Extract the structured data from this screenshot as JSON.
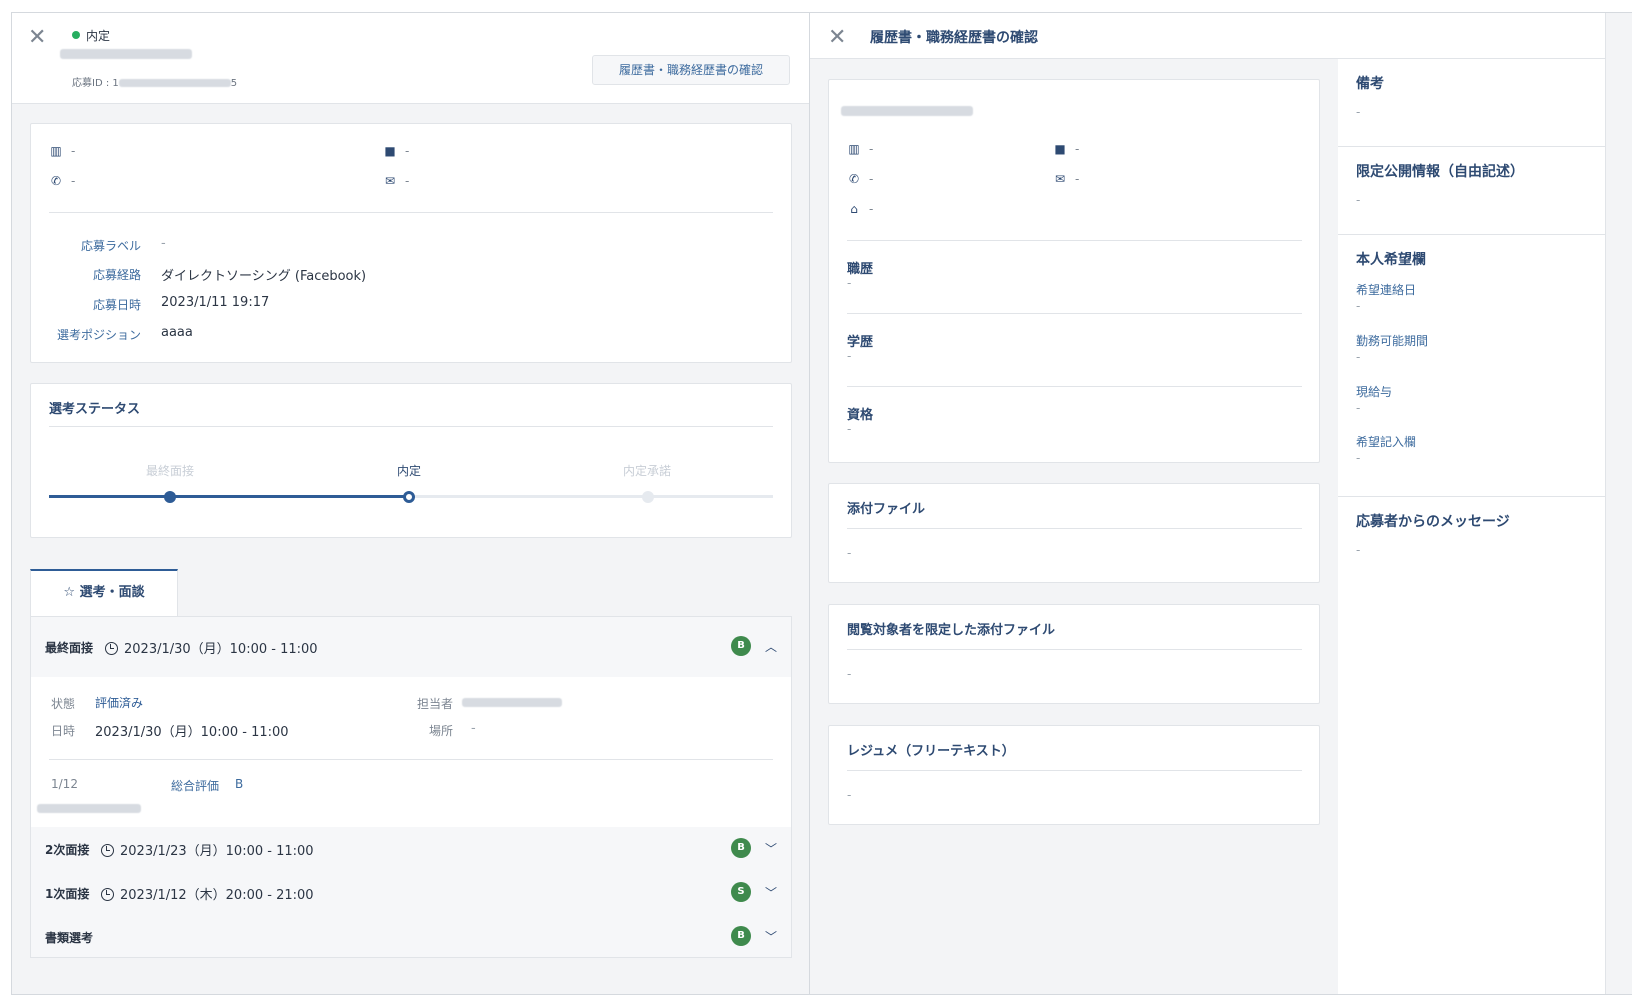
{
  "left": {
    "status": "内定",
    "app_id_label": "応募ID : 1",
    "app_id_suffix": "5",
    "resume_button": "履歴書・職務経歴書の確認",
    "contact": {
      "company": "-",
      "job": "-",
      "phone": "-",
      "email": "-"
    },
    "info": [
      {
        "label": "応募ラベル",
        "value": "-"
      },
      {
        "label": "応募経路",
        "value": "ダイレクトソーシング (Facebook)"
      },
      {
        "label": "応募日時",
        "value": "2023/1/11 19:17"
      },
      {
        "label": "選考ポジション",
        "value": "aaaa"
      }
    ],
    "selection_status": {
      "title": "選考ステータス",
      "steps": [
        "最終面接",
        "内定",
        "内定承諾"
      ],
      "current_step": 2
    },
    "tab_label": "選考・面談",
    "interviews": [
      {
        "name": "最終面接",
        "time": "2023/1/30（月）10:00 - 11:00",
        "grade": "B",
        "expanded": true
      },
      {
        "name": "2次面接",
        "time": "2023/1/23（月）10:00 - 11:00",
        "grade": "B",
        "expanded": false
      },
      {
        "name": "1次面接",
        "time": "2023/1/12（木）20:00 - 21:00",
        "grade": "S",
        "expanded": false
      },
      {
        "name": "書類選考",
        "time": "",
        "grade": "B",
        "expanded": false
      }
    ],
    "detail": {
      "state_label": "状態",
      "state_value": "評価済み",
      "date_label": "日時",
      "date_value": "2023/1/30（月）10:00 - 11:00",
      "owner_label": "担当者",
      "place_label": "場所",
      "place_value": "-",
      "count": "1/12",
      "overall_label": "総合評価",
      "overall_value": "B"
    },
    "colors": {
      "accent": "#2e5c96",
      "badge": "#3f8a4d",
      "status_dot": "#27ae60"
    }
  },
  "right": {
    "title": "履歴書・職務経歴書の確認",
    "contact": {
      "company": "-",
      "job": "-",
      "phone": "-",
      "email": "-",
      "home": "-"
    },
    "sections": [
      {
        "title": "職歴",
        "value": "-"
      },
      {
        "title": "学歴",
        "value": "-"
      },
      {
        "title": "資格",
        "value": "-"
      }
    ],
    "cards": [
      {
        "title": "添付ファイル",
        "value": "-"
      },
      {
        "title": "閲覧対象者を限定した添付ファイル",
        "value": "-"
      },
      {
        "title": "レジュメ（フリーテキスト）",
        "value": "-"
      }
    ],
    "side": {
      "notes_title": "備考",
      "notes_value": "-",
      "limited_title": "限定公開情報（自由記述）",
      "limited_value": "-",
      "wishes_title": "本人希望欄",
      "wishes": [
        {
          "label": "希望連絡日",
          "value": "-"
        },
        {
          "label": "勤務可能期間",
          "value": "-"
        },
        {
          "label": "現給与",
          "value": "-"
        },
        {
          "label": "希望記入欄",
          "value": "-"
        }
      ],
      "message_title": "応募者からのメッセージ",
      "message_value": "-"
    }
  }
}
